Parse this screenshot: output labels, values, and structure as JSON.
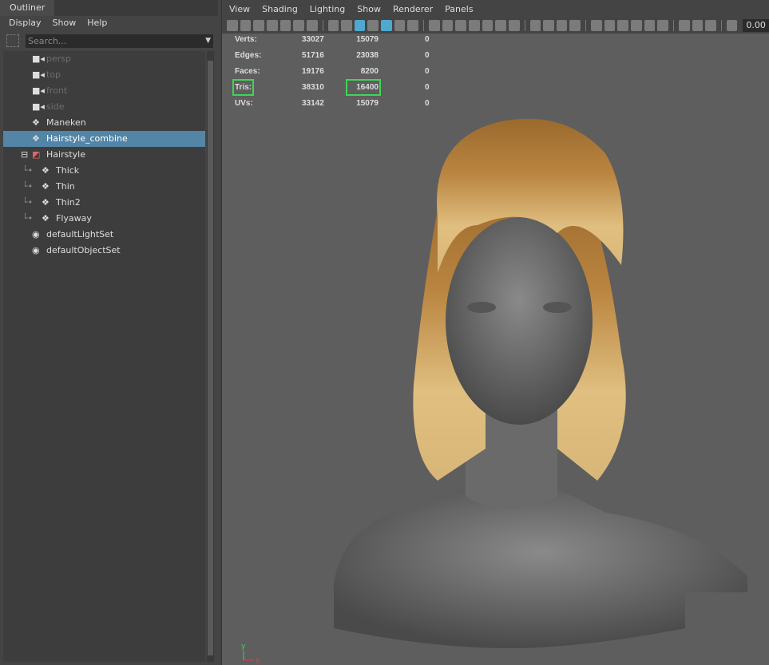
{
  "outliner": {
    "tab": "Outliner",
    "menu": [
      "Display",
      "Show",
      "Help"
    ],
    "search_placeholder": "Search...",
    "items": [
      {
        "label": "persp",
        "icon": "camera-icon"
      },
      {
        "label": "top",
        "icon": "camera-icon"
      },
      {
        "label": "front",
        "icon": "camera-icon"
      },
      {
        "label": "side",
        "icon": "camera-icon"
      },
      {
        "label": "Maneken",
        "icon": "transform-icon"
      },
      {
        "label": "Hairstyle_combine",
        "icon": "transform-icon"
      },
      {
        "label": "Hairstyle",
        "icon": "xgen-icon"
      },
      {
        "label": "Thick",
        "icon": "transform-icon"
      },
      {
        "label": "Thin",
        "icon": "transform-icon"
      },
      {
        "label": "Thin2",
        "icon": "transform-icon"
      },
      {
        "label": "Flyaway",
        "icon": "transform-icon"
      },
      {
        "label": "defaultLightSet",
        "icon": "set-icon"
      },
      {
        "label": "defaultObjectSet",
        "icon": "set-icon"
      }
    ]
  },
  "viewport": {
    "menu": [
      "View",
      "Shading",
      "Lighting",
      "Show",
      "Renderer",
      "Panels"
    ],
    "field_value": "0.00",
    "hud": [
      {
        "label": "Verts:",
        "a": "33027",
        "b": "15079",
        "c": "0"
      },
      {
        "label": "Edges:",
        "a": "51716",
        "b": "23038",
        "c": "0"
      },
      {
        "label": "Faces:",
        "a": "19176",
        "b": "8200",
        "c": "0"
      },
      {
        "label": "Tris:",
        "a": "38310",
        "b": "16400",
        "c": "0"
      },
      {
        "label": "UVs:",
        "a": "33142",
        "b": "15079",
        "c": "0"
      }
    ],
    "axis": {
      "y": "y",
      "x": "x"
    }
  },
  "colors": {
    "selection": "#5285a6",
    "highlight": "#3fd45a",
    "active_tool": "#4fa8cf"
  }
}
